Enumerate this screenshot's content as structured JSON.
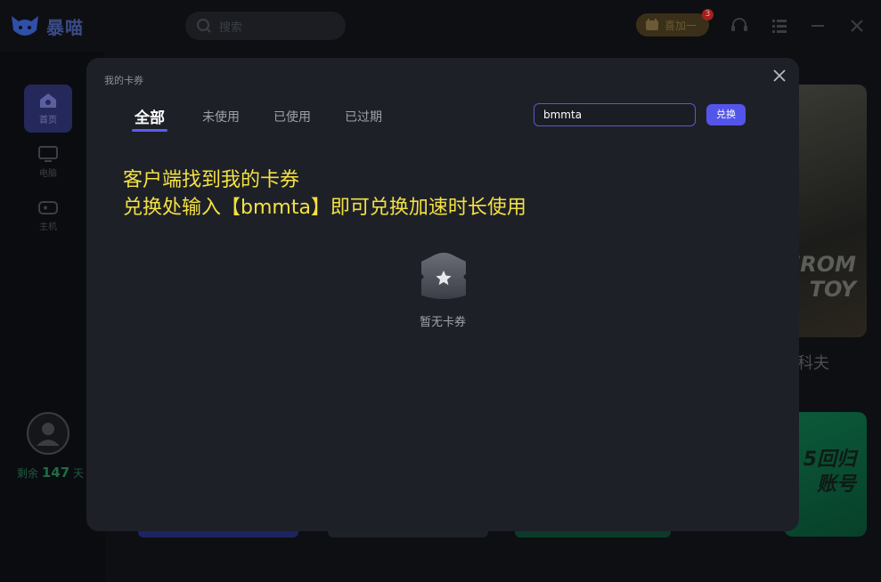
{
  "app": {
    "brand_name": "暴喵",
    "search_placeholder": "搜索",
    "speed_label": "喜加一",
    "speed_badge": "3",
    "nav": [
      {
        "label": "首页",
        "icon": "home-icon",
        "active": true
      },
      {
        "label": "电脑",
        "icon": "monitor-icon",
        "active": false
      },
      {
        "label": "主机",
        "icon": "gamepad-icon",
        "active": false
      }
    ],
    "remain_prefix": "剩余",
    "remain_days": "147",
    "remain_suffix": "天",
    "bg_card_text": "FROM\nTOY",
    "bg_card_caption": "科夫",
    "bg_green_text": "5回归\n账号"
  },
  "modal": {
    "title": "我的卡券",
    "tabs": [
      {
        "label": "全部",
        "active": true
      },
      {
        "label": "未使用",
        "active": false
      },
      {
        "label": "已使用",
        "active": false
      },
      {
        "label": "已过期",
        "active": false
      }
    ],
    "redeem_input_value": "bmmta",
    "redeem_button_label": "兑换",
    "notice_line1": "客户端找到我的卡券",
    "notice_line2": "兑换处输入【bmmta】即可兑换加速时长使用",
    "empty_text": "暂无卡券"
  },
  "colors": {
    "accent": "#5355ea",
    "notice": "#f3e142",
    "modal_bg": "#1e2028"
  }
}
